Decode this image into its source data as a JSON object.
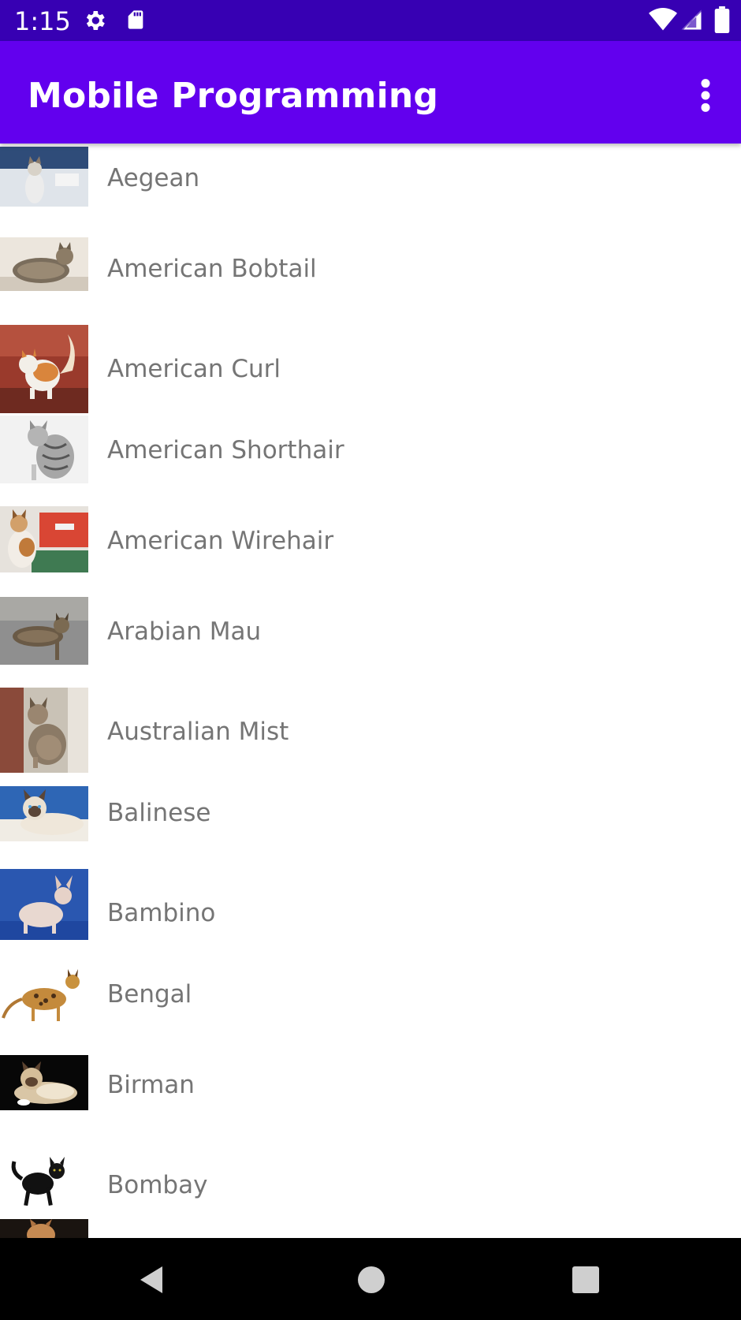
{
  "status_bar": {
    "time": "1:15",
    "icons": [
      "gear-icon",
      "sd-card-icon",
      "wifi-icon",
      "cell-signal-icon",
      "battery-icon"
    ]
  },
  "app_bar": {
    "title": "Mobile Programming",
    "overflow_icon": "more-vert-icon",
    "color": "#6200ee"
  },
  "breeds": [
    {
      "name": "Aegean"
    },
    {
      "name": "American Bobtail"
    },
    {
      "name": "American Curl"
    },
    {
      "name": "American Shorthair"
    },
    {
      "name": "American Wirehair"
    },
    {
      "name": "Arabian Mau"
    },
    {
      "name": "Australian Mist"
    },
    {
      "name": "Balinese"
    },
    {
      "name": "Bambino"
    },
    {
      "name": "Bengal"
    },
    {
      "name": "Birman"
    },
    {
      "name": "Bombay"
    }
  ],
  "nav_bar": {
    "icons": [
      "back-icon",
      "home-icon",
      "recents-icon"
    ]
  }
}
